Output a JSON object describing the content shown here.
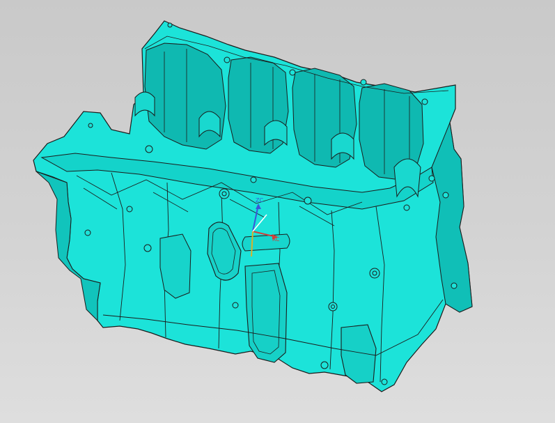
{
  "viewport": {
    "background_top": "#c9c9c9",
    "background_bottom": "#dedede"
  },
  "model": {
    "part_color": "#1ce3d9",
    "part_shade": "#13c9c0",
    "part_dark": "#0aa7a1",
    "edge_color": "#1b1b1b"
  },
  "triad": {
    "zc_label": "ZC",
    "xc_label": "XC",
    "zc_color": "#3a56d8",
    "xc_color": "#d1403a",
    "yc_color": "#d8b22a"
  }
}
